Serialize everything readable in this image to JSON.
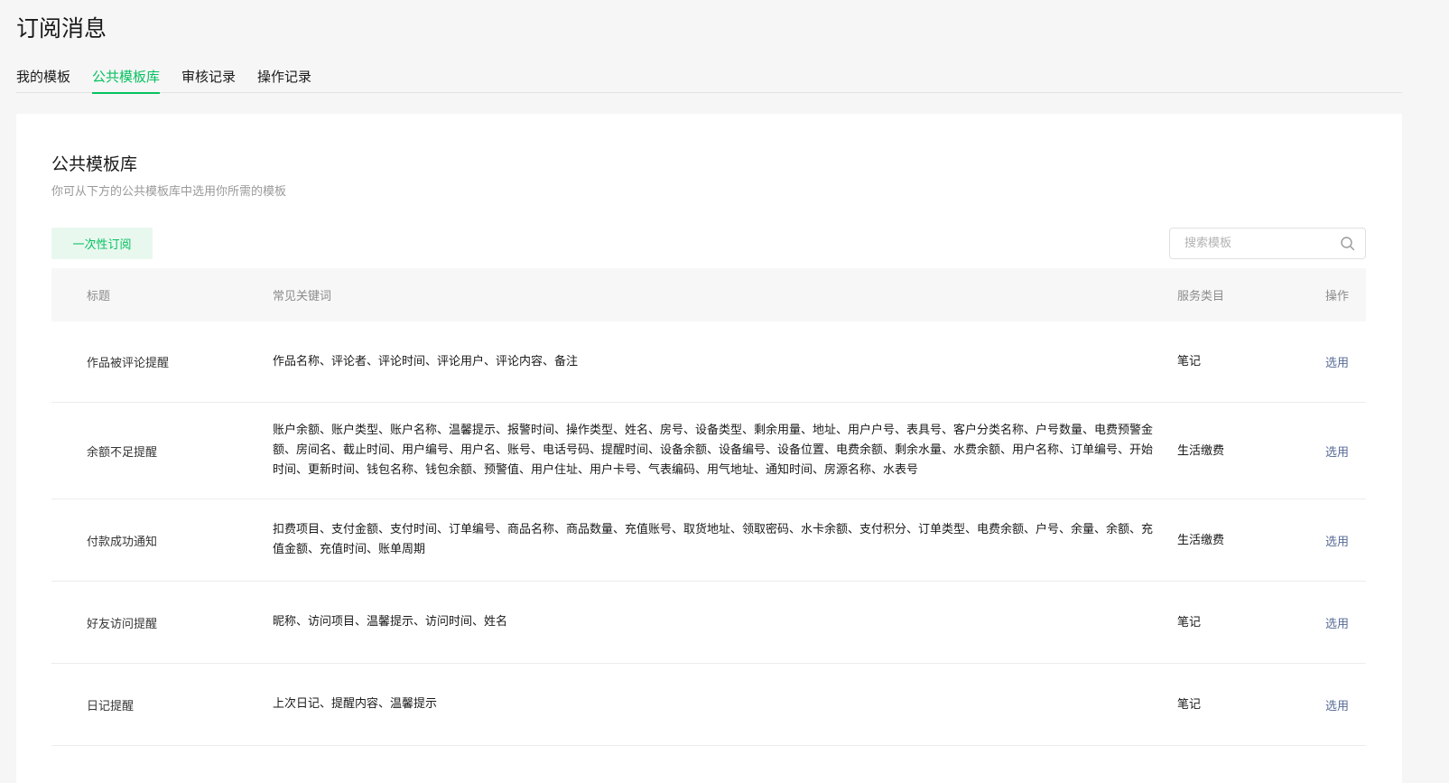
{
  "page": {
    "title": "订阅消息"
  },
  "tabs": [
    {
      "label": "我的模板",
      "active": false
    },
    {
      "label": "公共模板库",
      "active": true
    },
    {
      "label": "审核记录",
      "active": false
    },
    {
      "label": "操作记录",
      "active": false
    }
  ],
  "section": {
    "title": "公共模板库",
    "description": "你可从下方的公共模板库中选用你所需的模板"
  },
  "filter": {
    "label": "一次性订阅"
  },
  "search": {
    "placeholder": "搜索模板",
    "value": ""
  },
  "table": {
    "headers": {
      "title": "标题",
      "keywords": "常见关键词",
      "category": "服务类目",
      "action": "操作"
    },
    "rows": [
      {
        "title": "作品被评论提醒",
        "keywords": "作品名称、评论者、评论时间、评论用户、评论内容、备注",
        "category": "笔记",
        "action": "选用"
      },
      {
        "title": "余额不足提醒",
        "keywords": "账户余额、账户类型、账户名称、温馨提示、报警时间、操作类型、姓名、房号、设备类型、剩余用量、地址、用户户号、表具号、客户分类名称、户号数量、电费预警金额、房间名、截止时间、用户编号、用户名、账号、电话号码、提醒时间、设备余额、设备编号、设备位置、电费余额、剩余水量、水费余额、用户名称、订单编号、开始时间、更新时间、钱包名称、钱包余额、预警值、用户住址、用户卡号、气表编码、用气地址、通知时间、房源名称、水表号",
        "category": "生活缴费",
        "action": "选用"
      },
      {
        "title": "付款成功通知",
        "keywords": "扣费项目、支付金额、支付时间、订单编号、商品名称、商品数量、充值账号、取货地址、领取密码、水卡余额、支付积分、订单类型、电费余额、户号、余量、余额、充值金额、充值时间、账单周期",
        "category": "生活缴费",
        "action": "选用"
      },
      {
        "title": "好友访问提醒",
        "keywords": "昵称、访问项目、温馨提示、访问时间、姓名",
        "category": "笔记",
        "action": "选用"
      },
      {
        "title": "日记提醒",
        "keywords": "上次日记、提醒内容、温馨提示",
        "category": "笔记",
        "action": "选用"
      }
    ]
  },
  "colors": {
    "accent": "#07c160",
    "link": "#576b95",
    "muted": "#9a9a9a"
  },
  "icons": {
    "search": "search-icon"
  }
}
